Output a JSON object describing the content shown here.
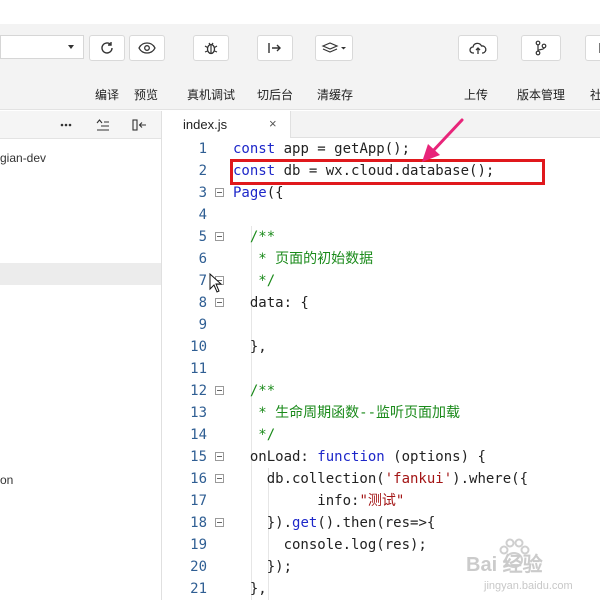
{
  "toolbar": {
    "buttons": [
      {
        "label": "编译",
        "icon": "refresh-icon"
      },
      {
        "label": "预览",
        "icon": "eye-icon"
      },
      {
        "label": "真机调试",
        "icon": "bug-icon"
      },
      {
        "label": "切后台",
        "icon": "switch-background-icon"
      },
      {
        "label": "清缓存",
        "icon": "layers-icon"
      },
      {
        "label": "上传",
        "icon": "cloud-upload-icon"
      },
      {
        "label": "版本管理",
        "icon": "branch-icon"
      },
      {
        "label": "社",
        "icon": "community-icon"
      }
    ]
  },
  "explorer": {
    "project_fragment": "gian-dev",
    "fragment_2": "on"
  },
  "editor": {
    "tab": {
      "name": "index.js",
      "close": "×"
    },
    "lines": [
      "1",
      "2",
      "3",
      "4",
      "5",
      "6",
      "7",
      "8",
      "9",
      "10",
      "11",
      "12",
      "13",
      "14",
      "15",
      "16",
      "17",
      "18",
      "19",
      "20",
      "21"
    ]
  },
  "colors": {
    "highlight_box": "#e0181c",
    "annotation_arrow": "#e8257a",
    "keyword": "#1d27c9",
    "string": "#a31515",
    "comment": "#1a8a1a"
  },
  "watermark": {
    "brand": "Bai 经验",
    "url": "jingyan.baidu.com"
  }
}
